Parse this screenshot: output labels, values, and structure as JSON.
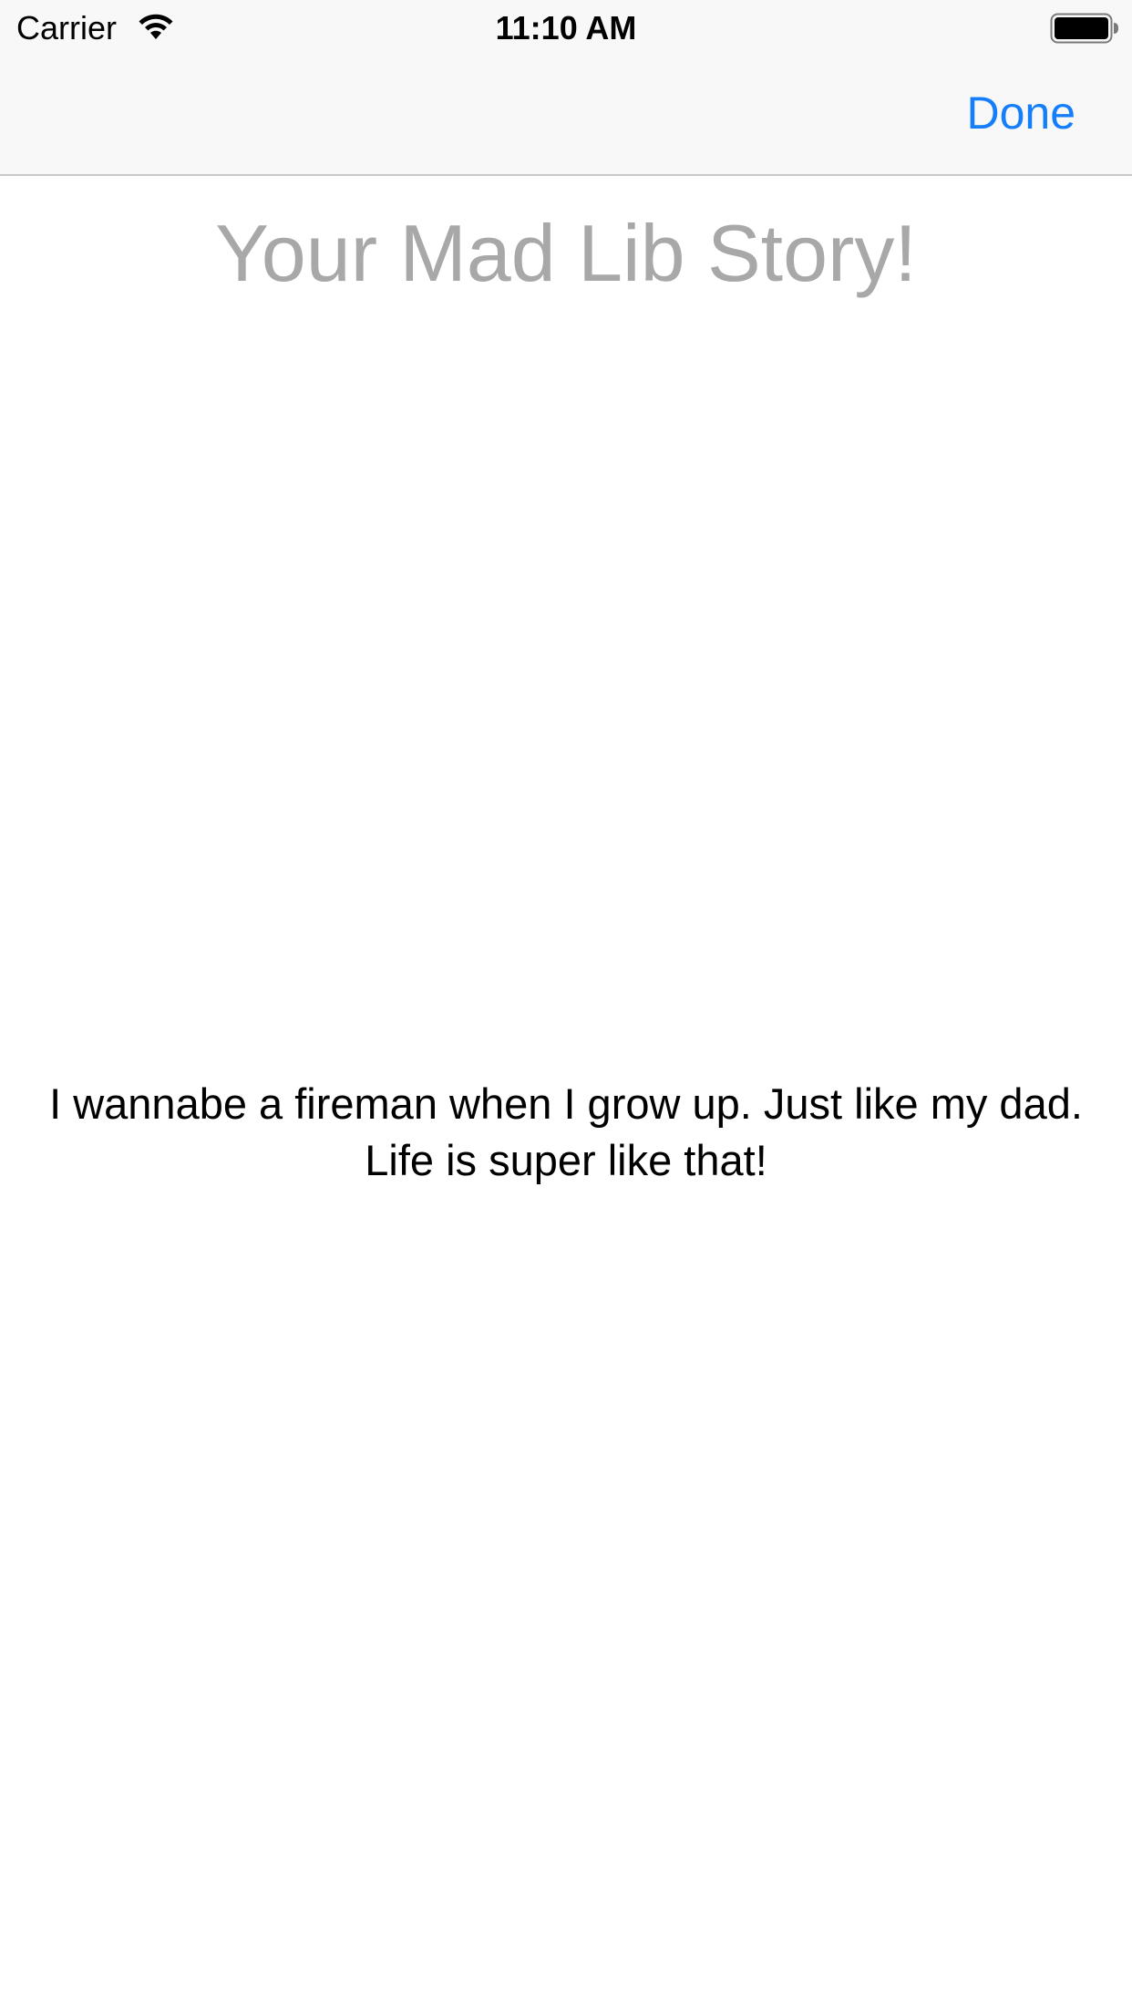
{
  "status_bar": {
    "carrier": "Carrier",
    "time": "11:10 AM",
    "icons": [
      "wifi-icon",
      "battery-icon"
    ]
  },
  "nav_bar": {
    "done_label": "Done",
    "accent_color": "#147efb"
  },
  "content": {
    "title": "Your Mad Lib Story!",
    "story": "I wannabe a fireman when I grow up. Just like my dad. Life is super like that!",
    "title_color": "#a8a8a8"
  }
}
